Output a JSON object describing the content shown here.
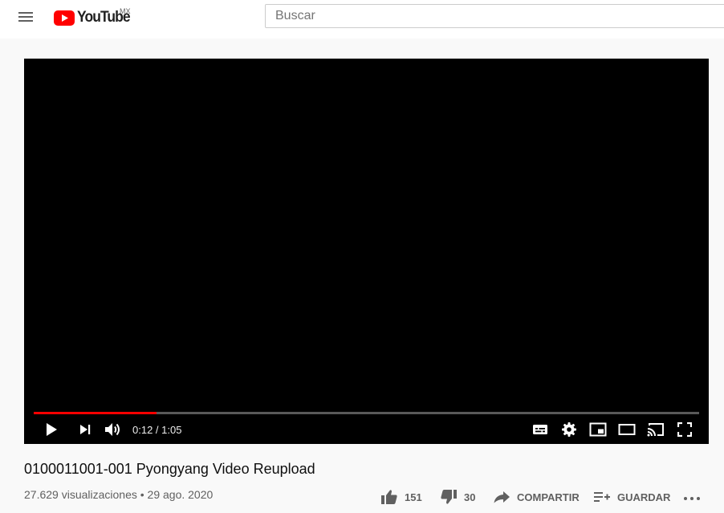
{
  "masthead": {
    "logo_text": "YouTube",
    "country_code": "MX",
    "search_placeholder": "Buscar"
  },
  "player": {
    "progress_fraction": 0.185,
    "current_time": "0:12",
    "duration": "1:05",
    "time_display": "0:12 / 1:05"
  },
  "video": {
    "title": "0100011001-001 Pyongyang Video Reupload",
    "views": "27.629 visualizaciones",
    "separator": "•",
    "date": "29 ago. 2020",
    "meta_line": "27.629 visualizaciones • 29 ago. 2020"
  },
  "actions": {
    "likes": "151",
    "dislikes": "30",
    "share_label": "COMPARTIR",
    "save_label": "GUARDAR"
  },
  "colors": {
    "brand_red": "#ff0000",
    "text_primary": "#0f0f0f",
    "text_secondary": "#606060"
  }
}
